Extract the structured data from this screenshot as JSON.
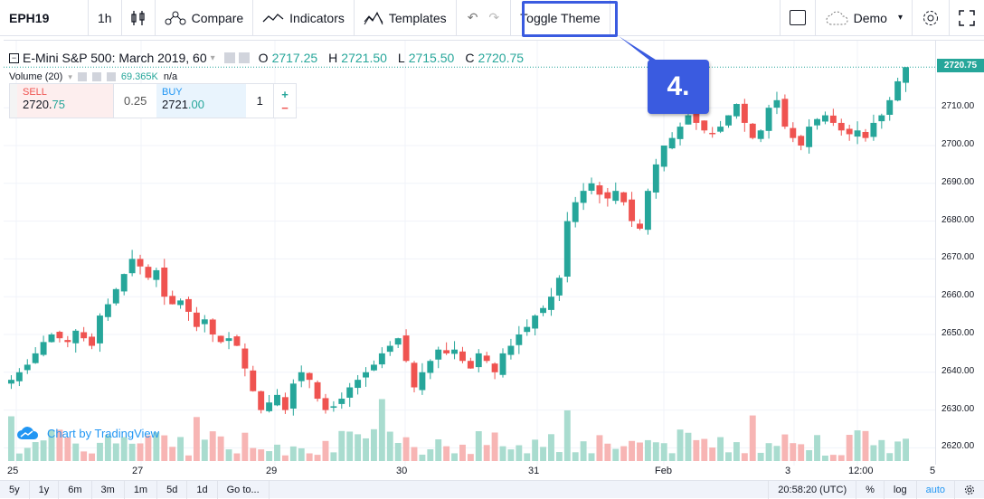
{
  "toolbar": {
    "symbol": "EPH19",
    "interval": "1h",
    "compare": "Compare",
    "indicators": "Indicators",
    "templates": "Templates",
    "toggle_theme": "Toggle Theme",
    "demo": "Demo"
  },
  "callout": "4.",
  "legend": {
    "title": "E-Mini S&P 500: March 2019, 60",
    "o_label": "O",
    "o": "2717.25",
    "h_label": "H",
    "h": "2721.50",
    "l_label": "L",
    "l": "2715.50",
    "c_label": "C",
    "c": "2720.75"
  },
  "volume": {
    "label": "Volume (20)",
    "value": "69.365K",
    "na": "n/a"
  },
  "trade": {
    "sell_label": "SELL",
    "sell_price_main": "2720.",
    "sell_price_tail": "75",
    "spread": "0.25",
    "buy_label": "BUY",
    "buy_price_main": "2721",
    "buy_price_tail": ".00",
    "units": "1",
    "plus": "+",
    "minus": "−"
  },
  "watermark": "Chart by TradingView",
  "price_axis": {
    "last": "2720.75",
    "ticks": [
      "2710.00",
      "2700.00",
      "2690.00",
      "2680.00",
      "2670.00",
      "2660.00",
      "2650.00",
      "2640.00",
      "2630.00",
      "2620.00"
    ]
  },
  "x_axis": [
    "25",
    "27",
    "29",
    "30",
    "31",
    "Feb",
    "3",
    "12:00",
    "5"
  ],
  "bottom": {
    "ranges": [
      "5y",
      "1y",
      "6m",
      "3m",
      "1m",
      "5d",
      "1d"
    ],
    "goto": "Go to...",
    "time": "20:58:20 (UTC)",
    "pct": "%",
    "log": "log",
    "auto": "auto"
  },
  "colors": {
    "up": "#26a69a",
    "down": "#ef5350",
    "accent": "#3a5be0"
  },
  "chart_data": {
    "type": "candlestick",
    "close": [
      2638,
      2640,
      2642,
      2645,
      2648,
      2650,
      2649,
      2648,
      2651,
      2649,
      2647,
      2655,
      2658,
      2662,
      2666,
      2670,
      2668,
      2665,
      2667,
      2660,
      2658,
      2659,
      2656,
      2652,
      2654,
      2650,
      2648,
      2649,
      2647,
      2641,
      2635,
      2630,
      2632,
      2634,
      2630,
      2637,
      2640,
      2638,
      2633,
      2630,
      2631,
      2633,
      2636,
      2638,
      2640,
      2642,
      2645,
      2647,
      2649,
      2643,
      2636,
      2640,
      2643,
      2646,
      2645,
      2646,
      2643,
      2641,
      2645,
      2643,
      2640,
      2645,
      2647,
      2650,
      2652,
      2655,
      2657,
      2660,
      2665,
      2680,
      2685,
      2688,
      2690,
      2687,
      2686,
      2688,
      2685,
      2680,
      2678,
      2688,
      2695,
      2700,
      2702,
      2705,
      2708,
      2706,
      2704,
      2703,
      2705,
      2708,
      2711,
      2706,
      2702,
      2704,
      2710,
      2712,
      2705,
      2702,
      2700,
      2705,
      2707,
      2708,
      2706,
      2704,
      2703,
      2704,
      2702,
      2706,
      2708,
      2712,
      2717,
      2720.75
    ]
  }
}
